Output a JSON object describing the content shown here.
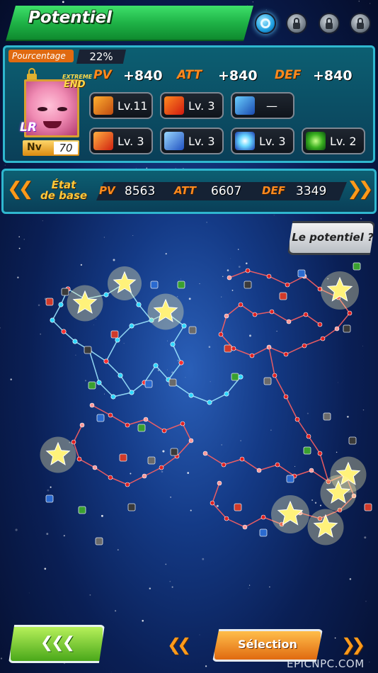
{
  "header": {
    "title": "Potentiel"
  },
  "routes": [
    {
      "name": "route-1",
      "state": "active",
      "icon": "ring-icon"
    },
    {
      "name": "route-2",
      "state": "locked",
      "icon": "lock-icon"
    },
    {
      "name": "route-3",
      "state": "locked",
      "icon": "lock-icon"
    },
    {
      "name": "route-4",
      "state": "locked",
      "icon": "lock-icon"
    }
  ],
  "potential": {
    "label": "Pourcentage",
    "value": "22%"
  },
  "character": {
    "tag_top": "EXTREME",
    "tag_bottom": "END",
    "rarity": "LR",
    "level_label": "Nv",
    "level_value": "70"
  },
  "stats": {
    "pv": {
      "label": "PV",
      "value": "+840"
    },
    "att": {
      "label": "ATT",
      "value": "+840"
    },
    "def": {
      "label": "DEF",
      "value": "+840"
    }
  },
  "skills": [
    {
      "icon": "fist-punch-icon",
      "text": "Lv.11"
    },
    {
      "icon": "fist-fire-icon",
      "text": "Lv. 3"
    },
    {
      "icon": "dash-icon",
      "text": "—"
    },
    {
      "icon": "goku-silhouette-icon",
      "text": "Lv. 3"
    },
    {
      "icon": "goku-portrait-icon",
      "text": "Lv. 3"
    },
    {
      "icon": "energy-blast-icon",
      "text": "Lv. 3"
    },
    {
      "icon": "green-orb-icon",
      "text": "Lv. 2"
    }
  ],
  "base_state": {
    "title_line1": "État",
    "title_line2": "de base",
    "pv_label": "PV",
    "pv_value": "8563",
    "att_label": "ATT",
    "att_value": "6607",
    "def_label": "DEF",
    "def_value": "3349",
    "prev_icon": "double-chevron-left-icon",
    "next_icon": "double-chevron-right-icon"
  },
  "help_button": {
    "label": "Le potentiel ?"
  },
  "footer": {
    "back_label": "❮❮❮",
    "select_label": "Sélection",
    "watermark": "EPICNPC.COM"
  },
  "colors": {
    "accent_orange": "#ff8a1e",
    "header_green": "#1fb347",
    "panel_teal": "#0c5f72",
    "panel_border": "#2fb7cf"
  }
}
